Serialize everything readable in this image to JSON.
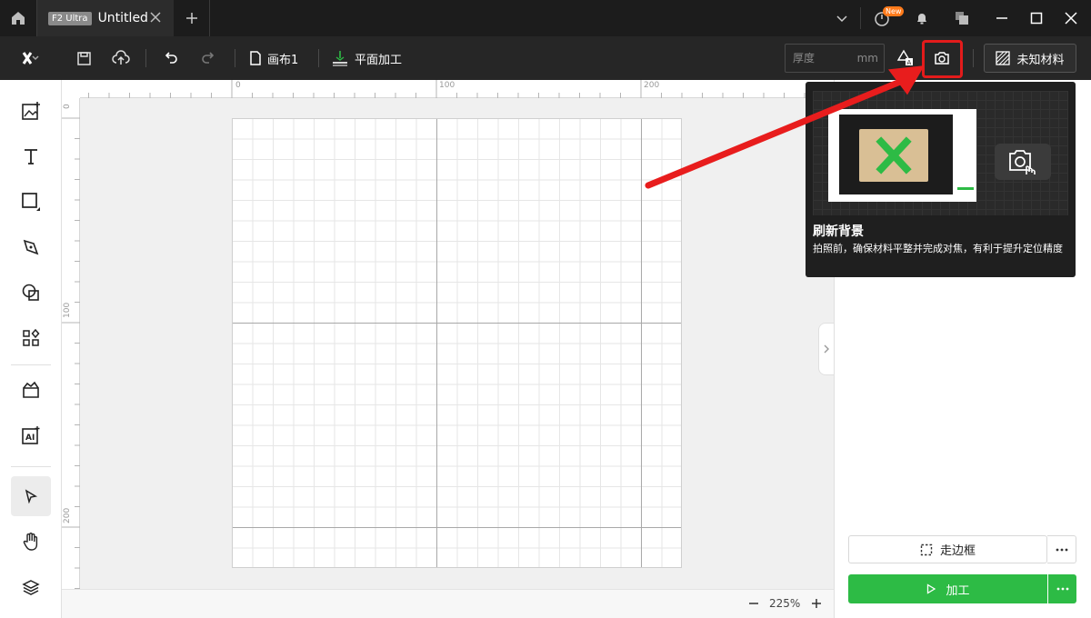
{
  "titlebar": {
    "tab": {
      "badge": "F2 Ultra",
      "title": "Untitled"
    },
    "notification_badge": "New"
  },
  "toolbar": {
    "canvas_label": "画布1",
    "mode_label": "平面加工",
    "thickness": {
      "value": "",
      "placeholder": "厚度",
      "unit": "mm"
    },
    "material_label": "未知材料"
  },
  "zoom": {
    "value": "225%"
  },
  "ruler": {
    "horizontal": [
      "0",
      "100",
      "200"
    ],
    "vertical": [
      "0",
      "100",
      "200"
    ]
  },
  "actions": {
    "frame_label": "走边框",
    "process_label": "加工"
  },
  "tooltip": {
    "title": "刷新背景",
    "description": "拍照前，确保材料平整并完成对焦，有利于提升定位精度"
  },
  "colors": {
    "accent_green": "#2dbb45",
    "highlight_red": "#e31b1b",
    "badge_orange": "#ff7a1a",
    "titlebar_bg": "#1c1c1c",
    "toolbar_bg": "#262626"
  },
  "icons": {
    "home": "home-icon",
    "close": "close-icon",
    "plus": "plus-icon",
    "chevron": "chevron-down-icon",
    "power": "power-icon",
    "bell": "bell-icon",
    "copy": "windows-icon",
    "minimize": "minimize-icon",
    "maximize": "maximize-icon",
    "win_close": "window-close-icon",
    "logo": "xtool-logo-icon",
    "save": "save-icon",
    "cloud": "cloud-upload-icon",
    "undo": "undo-icon",
    "redo": "redo-icon",
    "file": "file-icon",
    "laser": "laser-mode-icon",
    "shapes_text": "material-shapes-icon",
    "camera": "camera-refresh-icon",
    "material": "material-hatch-icon"
  }
}
